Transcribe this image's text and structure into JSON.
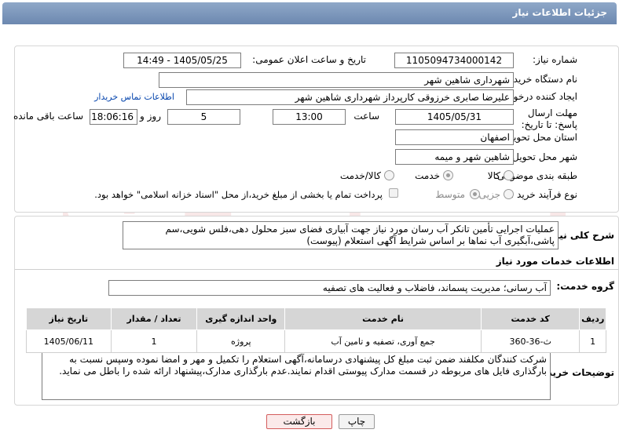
{
  "header": {
    "title": "جزئیات اطلاعات نیاز"
  },
  "fields": {
    "need_number_label": "شماره نیاز:",
    "need_number": "1105094734000142",
    "announce_label": "تاریخ و ساعت اعلان عمومی:",
    "announce_value": "1405/05/25 - 14:49",
    "buyer_org_label": "نام دستگاه خریدار:",
    "buyer_org": "شهرداری شاهین شهر",
    "creator_label": "ایجاد کننده درخواست:",
    "creator": "علیرضا صابری خرزوقی کارپرداز شهرداری شاهین شهر",
    "contact_link": "اطلاعات تماس خریدار",
    "deadline_label": "مهلت ارسال پاسخ: تا تاریخ:",
    "deadline_date": "1405/05/31",
    "time_label": "ساعت",
    "deadline_time": "13:00",
    "days_value": "5",
    "days_label": "روز و",
    "remaining_time": "18:06:16",
    "remaining_label": "ساعت باقی مانده",
    "province_label": "استان محل تحویل:",
    "province": "اصفهان",
    "city_label": "شهر محل تحویل:",
    "city": "شاهین شهر و میمه",
    "category_label": "طبقه بندی موضوعی:",
    "category_options": [
      "کالا",
      "خدمت",
      "کالا/خدمت"
    ],
    "category_selected": "خدمت",
    "process_label": "نوع فرآیند خرید :",
    "process_options": [
      "جزیی",
      "متوسط"
    ],
    "process_selected": "متوسط",
    "payment_note": "پرداخت تمام یا بخشی از مبلغ خرید،از محل \"اسناد خزانه اسلامی\" خواهد بود."
  },
  "summary": {
    "label": "شرح کلی نیاز:",
    "text": "عملیات اجرایی تأمین تانکر آب رسان مورد نیاز جهت آبیاری فضای سبز محلول دهی،فلس شویی،سم پاشی،آبگیری آب نماها بر اساس شرایط آگهی استعلام (پیوست)"
  },
  "services": {
    "section_title": "اطلاعات خدمات مورد نیاز",
    "group_label": "گروه خدمت:",
    "group_value": "آب رسانی؛ مدیریت پسماند، فاضلاب و فعالیت های تصفیه",
    "columns": [
      "ردیف",
      "کد خدمت",
      "نام خدمت",
      "واحد اندازه گیری",
      "تعداد / مقدار",
      "تاریخ نیاز"
    ],
    "rows": [
      [
        "1",
        "ث-36-360",
        "جمع آوری، تصفیه و تامین آب",
        "پروژه",
        "1",
        "1405/06/11"
      ]
    ]
  },
  "buyer_notes": {
    "label": "توضیحات خریدار:",
    "text": "شرکت کنندگان مکلفند ضمن ثبت مبلغ کل پیشنهادی درسامانه،آگهی استعلام را  تکمیل و مهر و امضا نموده وسپس نسبت به بارگذاری فایل های مربوطه در قسمت مدارک پیوستی اقدام نمایند.عدم بارگذاری مدارک،پیشنهاد ارائه شده را باطل می نماید."
  },
  "buttons": {
    "print": "چاپ",
    "back": "بازگشت"
  },
  "watermark": "AriaTender.neT",
  "colors": {
    "header": "#7d96bb",
    "link": "#0645ad",
    "back_border": "#d45d5d"
  }
}
